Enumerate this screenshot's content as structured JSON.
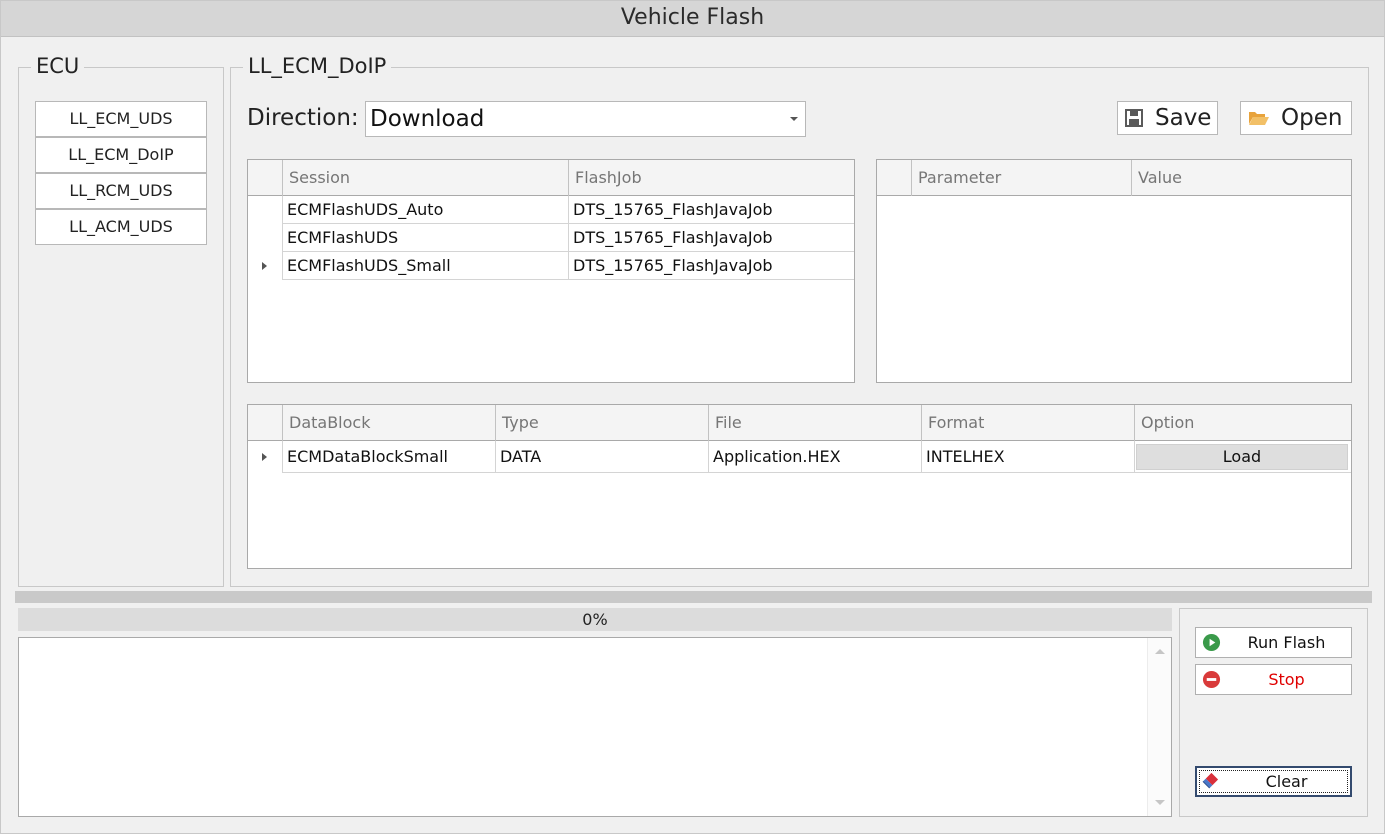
{
  "window": {
    "title": "Vehicle Flash"
  },
  "ecu_panel": {
    "legend": "ECU",
    "items": [
      "LL_ECM_UDS",
      "LL_ECM_DoIP",
      "LL_RCM_UDS",
      "LL_ACM_UDS"
    ]
  },
  "main_panel": {
    "legend": "LL_ECM_DoIP",
    "direction_label": "Direction:",
    "direction_value": "Download",
    "save_label": "Save",
    "open_label": "Open"
  },
  "session_grid": {
    "columns": [
      "Session",
      "FlashJob"
    ],
    "rows": [
      {
        "session": "ECMFlashUDS_Auto",
        "flashjob": "DTS_15765_FlashJavaJob"
      },
      {
        "session": "ECMFlashUDS",
        "flashjob": "DTS_15765_FlashJavaJob"
      },
      {
        "session": "ECMFlashUDS_Small",
        "flashjob": "DTS_15765_FlashJavaJob"
      }
    ],
    "current_row": 2
  },
  "param_grid": {
    "columns": [
      "Parameter",
      "Value"
    ],
    "rows": []
  },
  "datablock_grid": {
    "columns": [
      "DataBlock",
      "Type",
      "File",
      "Format",
      "Option"
    ],
    "rows": [
      {
        "datablock": "ECMDataBlockSmall",
        "type": "DATA",
        "file": "Application.HEX",
        "format": "INTELHEX",
        "option": "Load"
      }
    ]
  },
  "progress": {
    "text": "0%",
    "value": 0
  },
  "log": {
    "text": ""
  },
  "actions": {
    "run_flash": "Run Flash",
    "stop": "Stop",
    "clear": "Clear"
  },
  "colors": {
    "run_icon": "#3a9a4a",
    "stop_icon": "#d93a3a",
    "stop_text": "#e00000",
    "save_icon": "#5a5a5a",
    "open_icon": "#e8a33c"
  },
  "icons": {
    "save": "floppy-disk-icon",
    "open": "folder-open-icon",
    "run_flash": "play-circle-icon",
    "stop": "stop-circle-icon",
    "clear": "eraser-icon"
  }
}
